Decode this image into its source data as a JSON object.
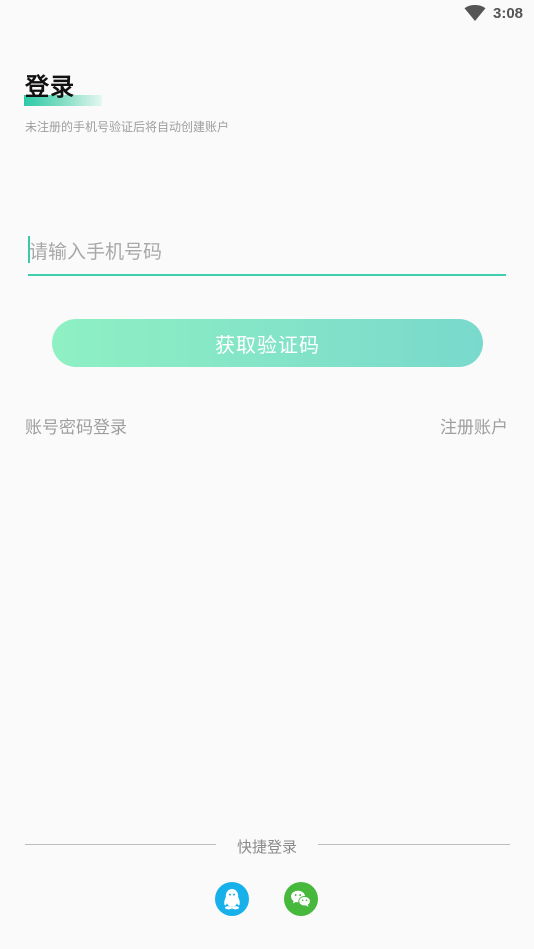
{
  "status_bar": {
    "time": "3:08",
    "wifi_icon": "wifi-icon"
  },
  "header": {
    "title": "登录",
    "subtitle": "未注册的手机号验证后将自动创建账户"
  },
  "phone_input": {
    "placeholder": "请输入手机号码",
    "value": ""
  },
  "actions": {
    "get_code_label": "获取验证码",
    "password_login_label": "账号密码登录",
    "register_label": "注册账户"
  },
  "quick_login": {
    "label": "快捷登录",
    "options": [
      {
        "name": "qq-icon"
      },
      {
        "name": "wechat-icon"
      }
    ]
  },
  "colors": {
    "accent": "#3fcfae",
    "button_gradient_start": "#8ef0c3",
    "button_gradient_end": "#79d9cc",
    "qq": "#17b1ea",
    "wechat": "#46b93c",
    "muted_text": "#9e9e9e",
    "background": "#fafafa"
  }
}
